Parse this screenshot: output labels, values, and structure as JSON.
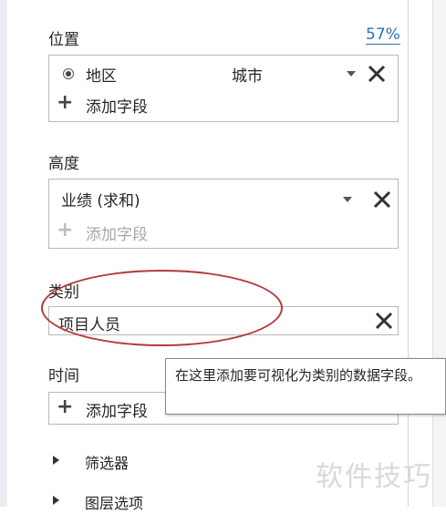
{
  "location": {
    "label": "位置",
    "percent": "57%",
    "field_name": "地区",
    "field_value": "城市",
    "add_field": "添加字段"
  },
  "height": {
    "label": "高度",
    "field_name": "业绩 (求和)",
    "add_field": "添加字段"
  },
  "category": {
    "label": "类别",
    "field_name": "项目人员"
  },
  "time": {
    "label": "时间",
    "add_field": "添加字段"
  },
  "tooltip": {
    "text": "在这里添加要可视化为类别的数据字段。"
  },
  "sections": {
    "filters": "筛选器",
    "layer_options": "图层选项"
  },
  "watermark": "软件技巧",
  "colors": {
    "accent_link": "#2c6fb7",
    "highlight_ellipse": "#b43a3a"
  },
  "icons": [
    "radio-selected-icon",
    "dropdown-arrow-icon",
    "close-icon",
    "plus-icon",
    "triangle-right-icon"
  ]
}
